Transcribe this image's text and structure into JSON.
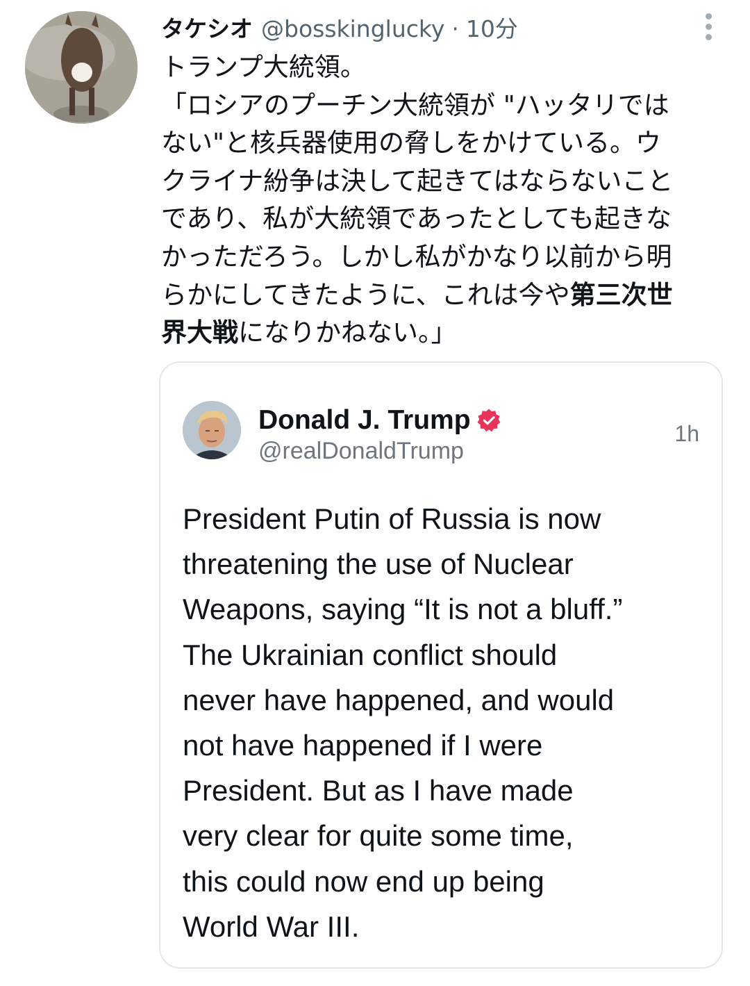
{
  "tweet": {
    "display_name": "タケシオ",
    "handle": "@bosskinglucky",
    "separator": "·",
    "time": "10分",
    "more_icon": "more-vertical-icon",
    "text_lines": [
      "トランプ大統領。",
      "「ロシアのプーチン大統領が \"ハッタリでは",
      "ない\"と核兵器使用の脅しをかけている。ウ",
      "クライナ紛争は決して起きてはならないこと",
      "であり、私が大統領であったとしても起きな",
      "かっただろう。しかし私がかなり以前から明"
    ],
    "line7_normal": "らかにしてきたように、これは今や",
    "line7_bold": "第三次世",
    "line8_bold": "界大戦",
    "line8_normal": "になりかねない。」"
  },
  "quote": {
    "display_name": "Donald J. Trump",
    "verified_icon": "verified-badge-icon",
    "handle": "@realDonaldTrump",
    "time": "1h",
    "text_lines": [
      "President Putin of Russia is now",
      "threatening the use of Nuclear",
      "Weapons, saying “It is not a bluff.”",
      "The Ukrainian conflict should",
      "never have happened, and would",
      "not have happened if I were",
      "President. But as I have made",
      "very clear for quite some time,",
      "this could now end up being",
      "World War III."
    ]
  },
  "colors": {
    "text_primary": "#0f1419",
    "text_secondary": "#536471",
    "border": "#e4e8eb",
    "verified_badge": "#e8335a"
  }
}
